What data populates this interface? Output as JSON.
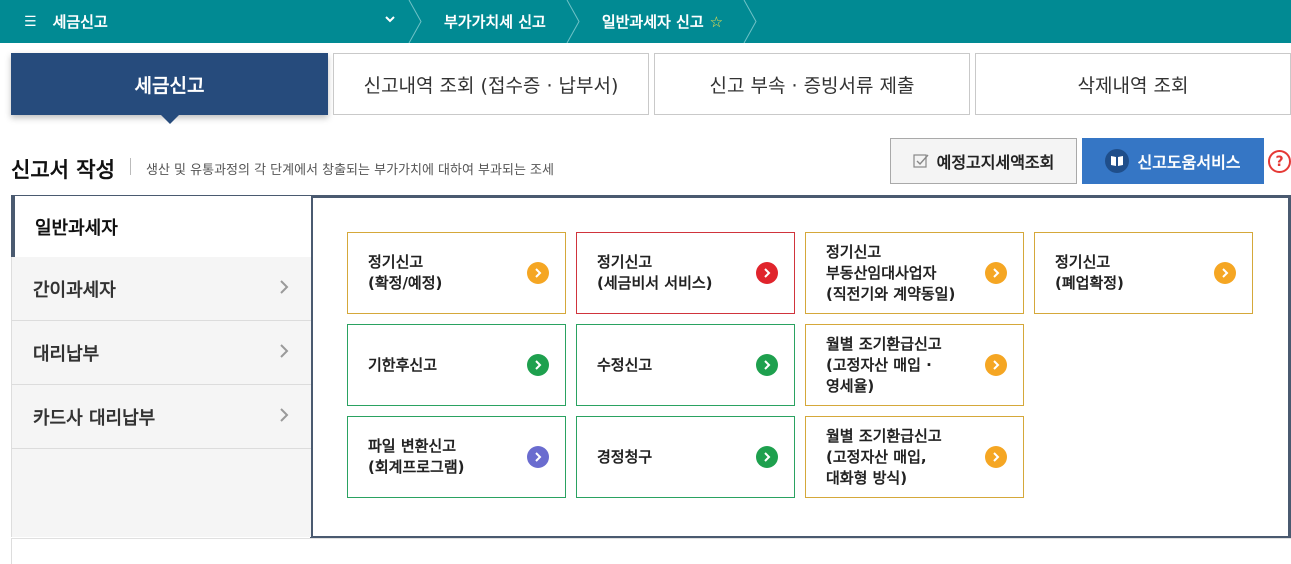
{
  "topbar": {
    "menu_label": "세금신고",
    "crumbs": [
      "부가가치세 신고",
      "일반과세자 신고"
    ]
  },
  "tabs": [
    "세금신고",
    "신고내역 조회 (접수증 · 납부서)",
    "신고 부속 · 증빙서류 제출",
    "삭제내역 조회"
  ],
  "section": {
    "title": "신고서 작성",
    "description": "생산 및 유통과정의 각 단계에서 창출되는 부가가치에 대하여 부과되는 조세",
    "notice_button": "예정고지세액조회",
    "help_button": "신고도움서비스",
    "help_icon": "?"
  },
  "sidebar": {
    "active": "일반과세자",
    "items": [
      "간이과세자",
      "대리납부",
      "카드사 대리납부"
    ]
  },
  "cards": [
    {
      "lines": [
        "정기신고",
        "(확정/예정)"
      ],
      "color": "#f5a623",
      "border": "orange"
    },
    {
      "lines": [
        "정기신고",
        "(세금비서 서비스)"
      ],
      "color": "#e0242c",
      "border": "red"
    },
    {
      "lines": [
        "정기신고",
        "부동산임대사업자",
        "(직전기와 계약동일)"
      ],
      "color": "#f5a623",
      "border": "orange"
    },
    {
      "lines": [
        "정기신고",
        "(폐업확정)"
      ],
      "color": "#f5a623",
      "border": "orange"
    },
    {
      "lines": [
        "기한후신고"
      ],
      "color": "#1ea04e",
      "border": "green"
    },
    {
      "lines": [
        "수정신고"
      ],
      "color": "#1ea04e",
      "border": "green"
    },
    {
      "lines": [
        "월별 조기환급신고",
        "(고정자산 매입 ·",
        "영세율)"
      ],
      "color": "#f5a623",
      "border": "orange"
    },
    {
      "lines": [
        "파일 변환신고",
        "(회계프로그램)"
      ],
      "color": "#6a6ccf",
      "border": "green"
    },
    {
      "lines": [
        "경정청구"
      ],
      "color": "#1ea04e",
      "border": "green"
    },
    {
      "lines": [
        "월별 조기환급신고",
        "(고정자산 매입,",
        "대화형 방식)"
      ],
      "color": "#f5a623",
      "border": "orange"
    }
  ]
}
